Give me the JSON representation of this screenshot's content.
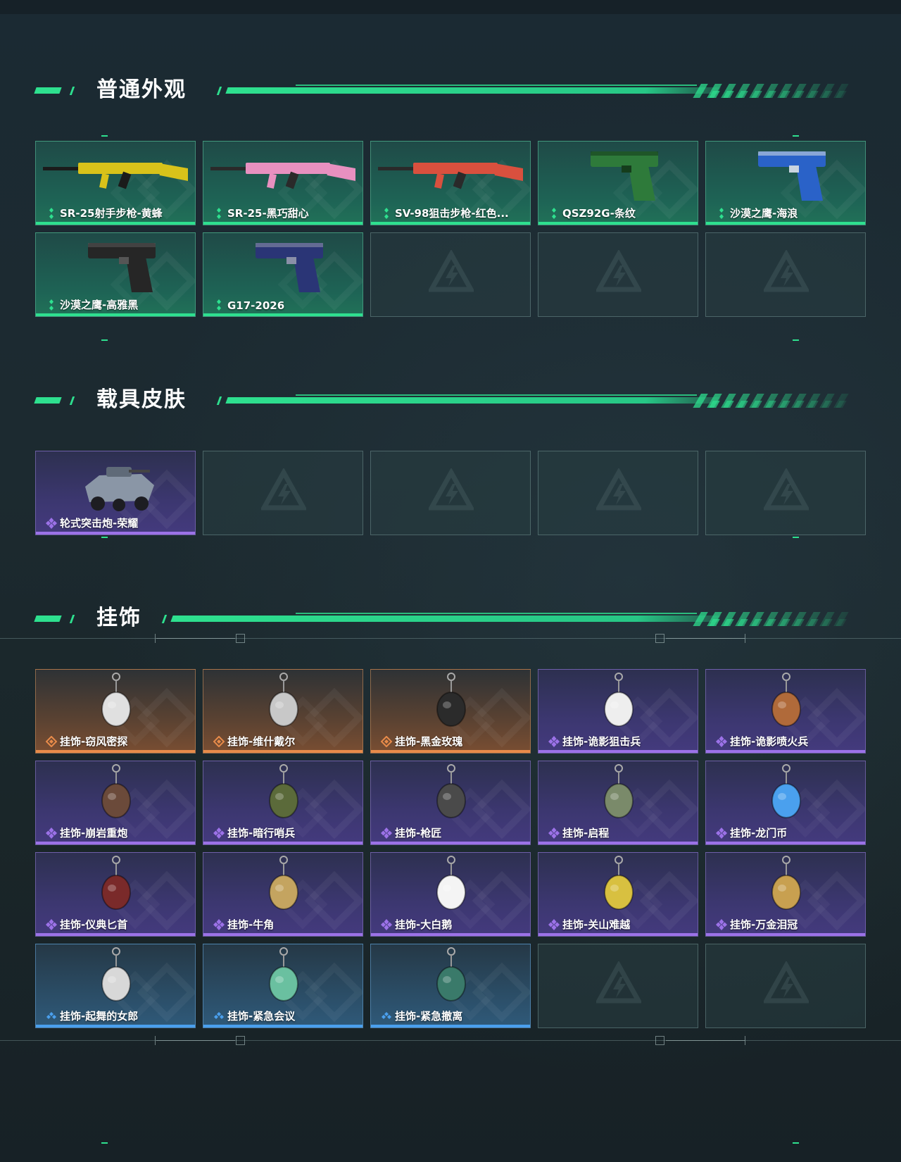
{
  "colors": {
    "accent": "#2ee08f",
    "rarity_green": "#2ee08f",
    "rarity_purple": "#9c72e8",
    "rarity_orange": "#e88b4a",
    "rarity_blue": "#4aa0ee"
  },
  "sections": [
    {
      "title": "普通外观",
      "items": [
        {
          "label": "SR-25射手步枪-黄蜂",
          "rarity": "green",
          "icon": "rifle-yellow-icon"
        },
        {
          "label": "SR-25-黑巧甜心",
          "rarity": "green",
          "icon": "rifle-pink-icon"
        },
        {
          "label": "SV-98狙击步枪-红色...",
          "rarity": "green",
          "icon": "sniper-red-icon"
        },
        {
          "label": "QSZ92G-条纹",
          "rarity": "green",
          "icon": "pistol-green-icon"
        },
        {
          "label": "沙漠之鹰-海浪",
          "rarity": "green",
          "icon": "pistol-wave-icon"
        },
        {
          "label": "沙漠之鹰-高雅黑",
          "rarity": "green",
          "icon": "pistol-black-icon"
        },
        {
          "label": "G17-2026",
          "rarity": "green",
          "icon": "pistol-navy-icon"
        },
        {
          "label": "",
          "rarity": "empty"
        },
        {
          "label": "",
          "rarity": "empty"
        },
        {
          "label": "",
          "rarity": "empty"
        }
      ]
    },
    {
      "title": "载具皮肤",
      "items": [
        {
          "label": "轮式突击炮-荣耀",
          "rarity": "purple",
          "icon": "vehicle-icon"
        },
        {
          "label": "",
          "rarity": "empty"
        },
        {
          "label": "",
          "rarity": "empty"
        },
        {
          "label": "",
          "rarity": "empty"
        },
        {
          "label": "",
          "rarity": "empty"
        }
      ]
    },
    {
      "title": "挂饰",
      "items": [
        {
          "label": "挂饰-窃风密探",
          "rarity": "orange",
          "icon": "charm-icon"
        },
        {
          "label": "挂饰-维什戴尔",
          "rarity": "orange",
          "icon": "charm-icon"
        },
        {
          "label": "挂饰-黑金玫瑰",
          "rarity": "orange",
          "icon": "charm-icon"
        },
        {
          "label": "挂饰-诡影狙击兵",
          "rarity": "purple",
          "icon": "charm-icon"
        },
        {
          "label": "挂饰-诡影喷火兵",
          "rarity": "purple",
          "icon": "charm-icon"
        },
        {
          "label": "挂饰-崩岩重炮",
          "rarity": "purple",
          "icon": "charm-icon"
        },
        {
          "label": "挂饰-暗行哨兵",
          "rarity": "purple",
          "icon": "charm-icon"
        },
        {
          "label": "挂饰-枪匠",
          "rarity": "purple",
          "icon": "charm-icon"
        },
        {
          "label": "挂饰-启程",
          "rarity": "purple",
          "icon": "charm-icon"
        },
        {
          "label": "挂饰-龙门币",
          "rarity": "purple",
          "icon": "charm-icon"
        },
        {
          "label": "挂饰-仪典匕首",
          "rarity": "purple",
          "icon": "charm-icon"
        },
        {
          "label": "挂饰-牛角",
          "rarity": "purple",
          "icon": "charm-icon"
        },
        {
          "label": "挂饰-大白鹅",
          "rarity": "purple",
          "icon": "charm-icon"
        },
        {
          "label": "挂饰-关山难越",
          "rarity": "purple",
          "icon": "charm-icon"
        },
        {
          "label": "挂饰-万金泪冠",
          "rarity": "purple",
          "icon": "charm-icon"
        },
        {
          "label": "挂饰-起舞的女郎",
          "rarity": "blue",
          "icon": "charm-icon"
        },
        {
          "label": "挂饰-紧急会议",
          "rarity": "blue",
          "icon": "charm-icon"
        },
        {
          "label": "挂饰-紧急撤离",
          "rarity": "blue",
          "icon": "charm-icon"
        },
        {
          "label": "",
          "rarity": "empty"
        },
        {
          "label": "",
          "rarity": "empty"
        }
      ]
    }
  ]
}
